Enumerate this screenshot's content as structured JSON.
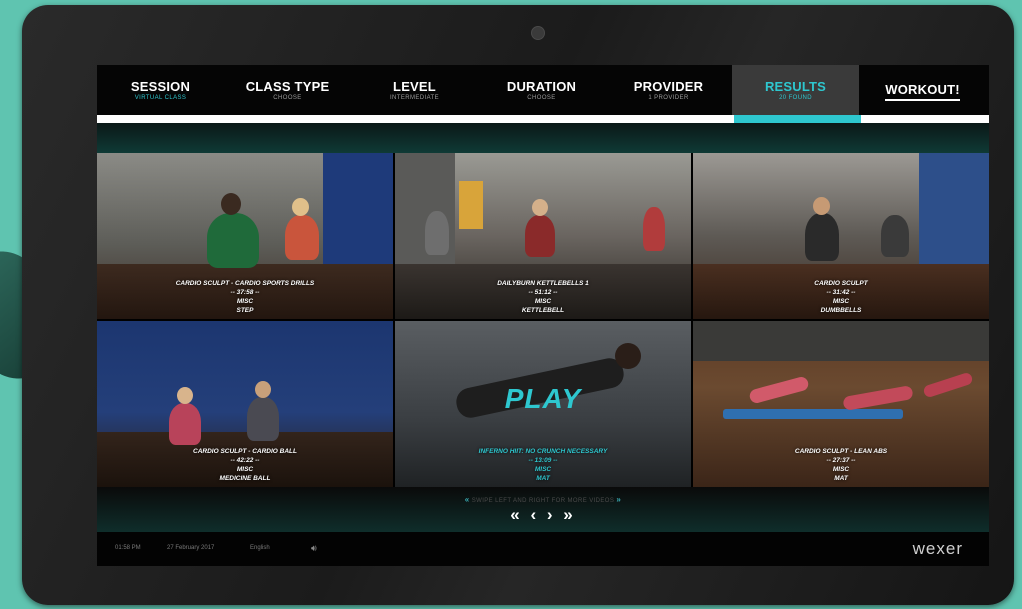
{
  "nav": [
    {
      "label": "SESSION",
      "sub": "VIRTUAL CLASS"
    },
    {
      "label": "CLASS TYPE",
      "sub": "CHOOSE"
    },
    {
      "label": "LEVEL",
      "sub": "INTERMEDIATE"
    },
    {
      "label": "DURATION",
      "sub": "CHOOSE"
    },
    {
      "label": "PROVIDER",
      "sub": "1 PROVIDER"
    },
    {
      "label": "RESULTS",
      "sub": "20 FOUND"
    },
    {
      "label": "WORKOUT!",
      "sub": ""
    }
  ],
  "progress_fraction": 0.857,
  "videos": [
    {
      "title": "CARDIO SCULPT - CARDIO SPORTS DRILLS",
      "duration": "-- 37:58 --",
      "category": "MISC",
      "equipment": "STEP"
    },
    {
      "title": "DAILYBURN KETTLEBELLS 1",
      "duration": "-- 51:12 --",
      "category": "MISC",
      "equipment": "KETTLEBELL"
    },
    {
      "title": "CARDIO SCULPT",
      "duration": "-- 31:42 --",
      "category": "MISC",
      "equipment": "DUMBBELLS"
    },
    {
      "title": "CARDIO SCULPT - CARDIO BALL",
      "duration": "-- 42:22 --",
      "category": "MISC",
      "equipment": "MEDICINE BALL"
    },
    {
      "title": "INFERNO HIIT: NO CRUNCH NECESSARY",
      "duration": "-- 13:09 --",
      "category": "MISC",
      "equipment": "MAT",
      "play_label": "PLAY"
    },
    {
      "title": "CARDIO SCULPT - LEAN ABS",
      "duration": "-- 27:37 --",
      "category": "MISC",
      "equipment": "MAT"
    }
  ],
  "pager": {
    "hint": "SWIPE LEFT AND RIGHT FOR MORE VIDEOS",
    "first": "«",
    "prev": "‹",
    "next": "›",
    "last": "»"
  },
  "footer": {
    "time": "01:58 PM",
    "date": "27 February 2017",
    "language": "English",
    "speaker_icon": "speaker-icon",
    "logo": "wexer"
  },
  "colors": {
    "accent": "#2ec7cf",
    "frame": "#5fc4b0"
  }
}
